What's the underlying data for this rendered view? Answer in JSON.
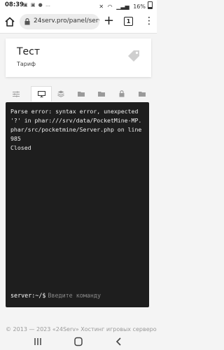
{
  "status_bar": {
    "time": "08:39",
    "left_icons": "▣ ▣ ● …",
    "battery": "16%",
    "icons": [
      "mute-icon",
      "wifi-icon",
      "signal-icon",
      "battery-icon"
    ]
  },
  "browser": {
    "url": "24serv.pro/panel/server/...",
    "tab_count": "1",
    "icons": [
      "home-icon",
      "lock-icon",
      "plus-icon",
      "menu-icon"
    ]
  },
  "server": {
    "name": "Тест",
    "plan": "Тариф"
  },
  "tabs": [
    {
      "icon": "sliders-icon",
      "active": false
    },
    {
      "icon": "monitor-icon",
      "active": true
    },
    {
      "icon": "layers-icon",
      "active": false
    },
    {
      "icon": "folder-icon",
      "active": false
    },
    {
      "icon": "folder-icon",
      "active": false
    },
    {
      "icon": "lock-icon",
      "active": false
    },
    {
      "icon": "folder-icon",
      "active": false
    }
  ],
  "console": {
    "output": "Parse error: syntax error, unexpected '?' in phar:///srv/data/PocketMine-MP.phar/src/pocketmine/Server.php on line 985\nClosed",
    "prompt": "server:~/$",
    "placeholder": "Введите команду"
  },
  "footer": {
    "text": "© 2013 — 2023 «24Serv» Хостинг игровых серверов"
  },
  "colors": {
    "console_bg": "#1e1e1e",
    "page_bg": "#f4f4f4"
  }
}
